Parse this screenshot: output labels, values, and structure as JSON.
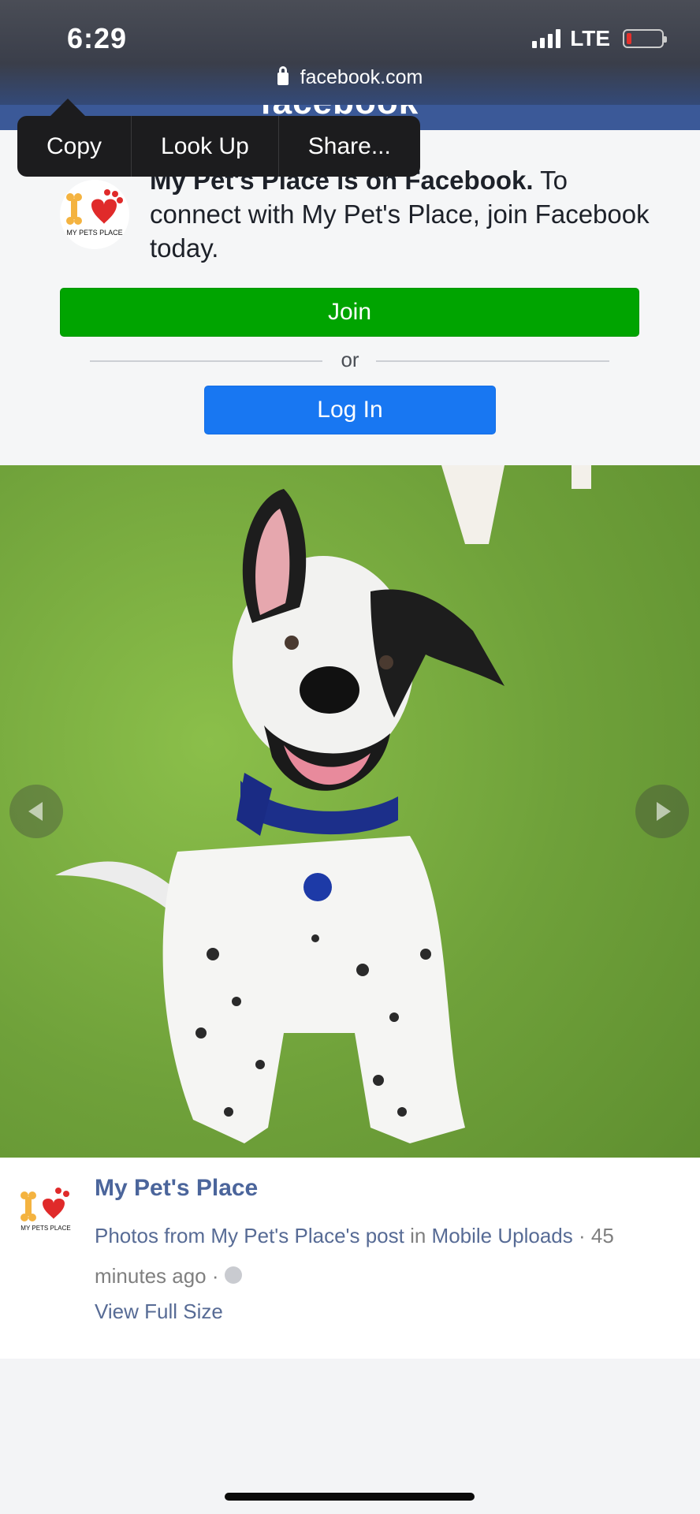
{
  "status_bar": {
    "time": "6:29",
    "network": "LTE"
  },
  "browser": {
    "url": "facebook.com",
    "fb_wordmark": "facebook"
  },
  "context_menu": {
    "items": [
      "Copy",
      "Look Up",
      "Share..."
    ]
  },
  "join_card": {
    "headline_bold": "My Pet's Place is on Facebook.",
    "headline_rest": " To connect with My Pet's Place, join Facebook today.",
    "join_label": "Join",
    "or_label": "or",
    "login_label": "Log In",
    "logo_text": "MY PETS PLACE"
  },
  "photo": {
    "description_icon": "dog-photo"
  },
  "post": {
    "page_name": "My Pet's Place",
    "meta_prefix": "Photos from My Pet's Place's post",
    "meta_in": " in ",
    "meta_album": "Mobile Uploads",
    "meta_time": " · 45 minutes ago · ",
    "view_full_size": "View Full Size"
  },
  "colors": {
    "join_green": "#00a400",
    "login_blue": "#1877f2",
    "fb_blue": "#3b5998",
    "link_color": "#576b95"
  }
}
